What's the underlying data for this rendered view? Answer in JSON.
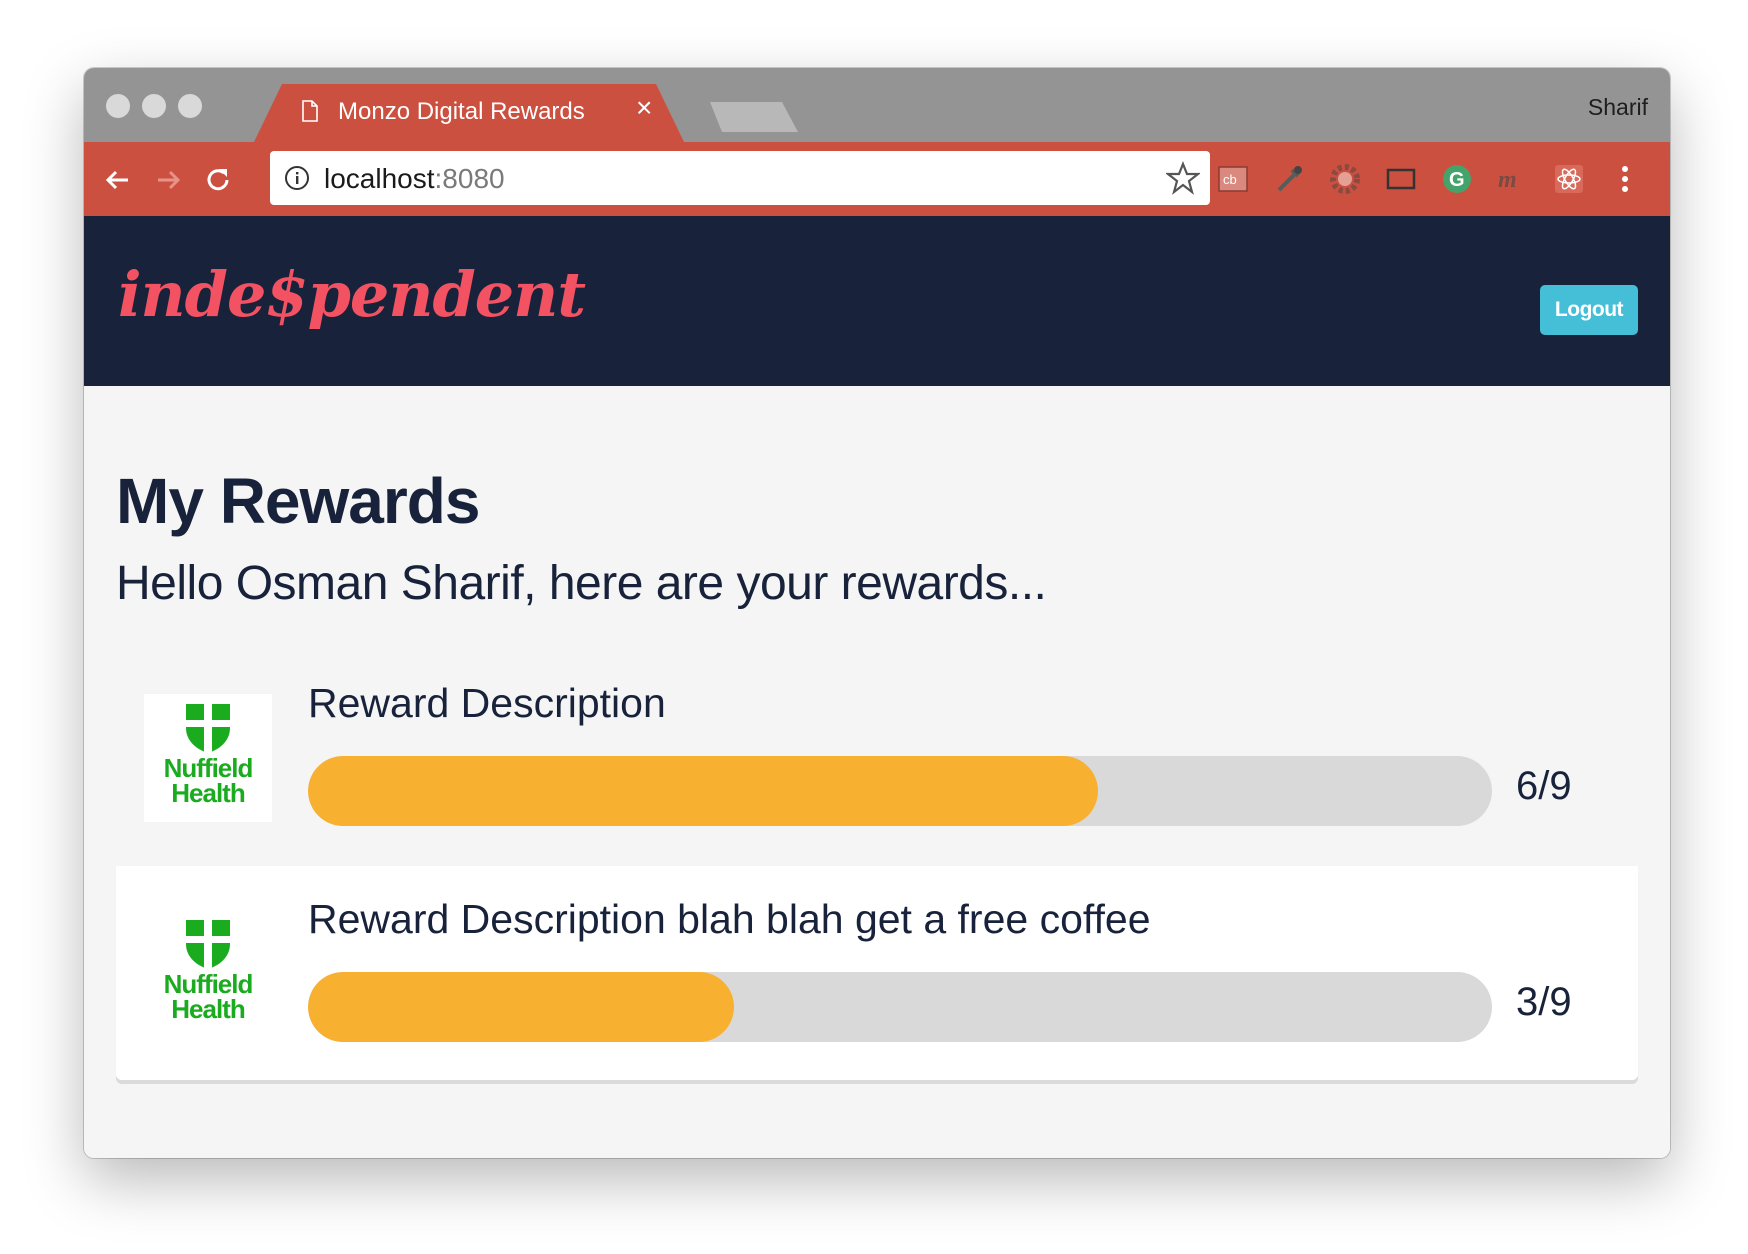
{
  "browser": {
    "tab_title": "Monzo Digital Rewards",
    "tab_close_icon": "close-icon",
    "profile_name": "Sharif",
    "url_host": "localhost",
    "url_port": ":8080"
  },
  "header": {
    "logo_text": "inde$pendent",
    "logout_label": "Logout"
  },
  "main": {
    "title": "My Rewards",
    "greeting": "Hello Osman Sharif, here are your rewards..."
  },
  "rewards": [
    {
      "brand": "Nuffield\nHealth",
      "description": "Reward Description",
      "progress_label": "6/9",
      "progress_fraction": 0.667
    },
    {
      "brand": "Nuffield\nHealth",
      "description": "Reward Description blah blah get a free coffee",
      "progress_label": "3/9",
      "progress_fraction": 0.36
    }
  ],
  "colors": {
    "browser_accent": "#cc5040",
    "header_bg": "#18233b",
    "logo": "#f25262",
    "logout_button": "#45bfd8",
    "progress_fill": "#f8b030",
    "progress_track": "#d9d9d9",
    "brand_green": "#1aab1f"
  }
}
